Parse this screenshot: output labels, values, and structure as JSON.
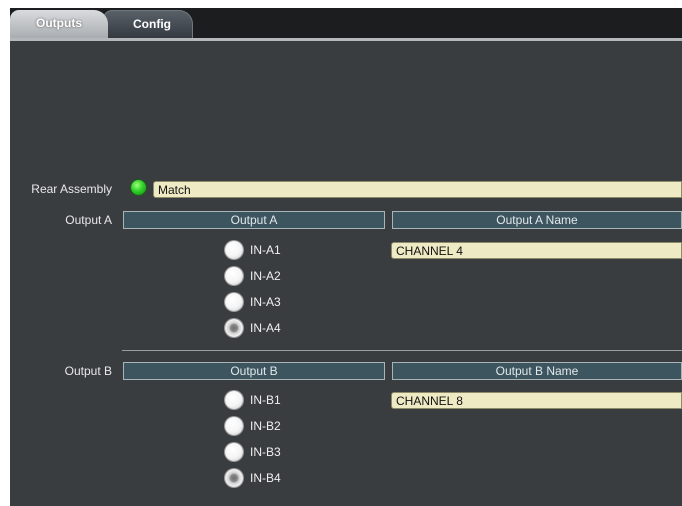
{
  "tabs": [
    {
      "label": "Outputs",
      "active": true
    },
    {
      "label": "Config",
      "active": false
    }
  ],
  "rear_assembly": {
    "label": "Rear Assembly",
    "status": "Match",
    "status_color": "#2fd02a"
  },
  "output_a": {
    "row_label": "Output A",
    "header": "Output A",
    "name_header": "Output A Name",
    "name_value": "CHANNEL 4",
    "options": [
      "IN-A1",
      "IN-A2",
      "IN-A3",
      "IN-A4"
    ],
    "selected": "IN-A4"
  },
  "output_b": {
    "row_label": "Output B",
    "header": "Output B",
    "name_header": "Output B Name",
    "name_value": "CHANNEL 8",
    "options": [
      "IN-B1",
      "IN-B2",
      "IN-B3",
      "IN-B4"
    ],
    "selected": "IN-B4"
  }
}
